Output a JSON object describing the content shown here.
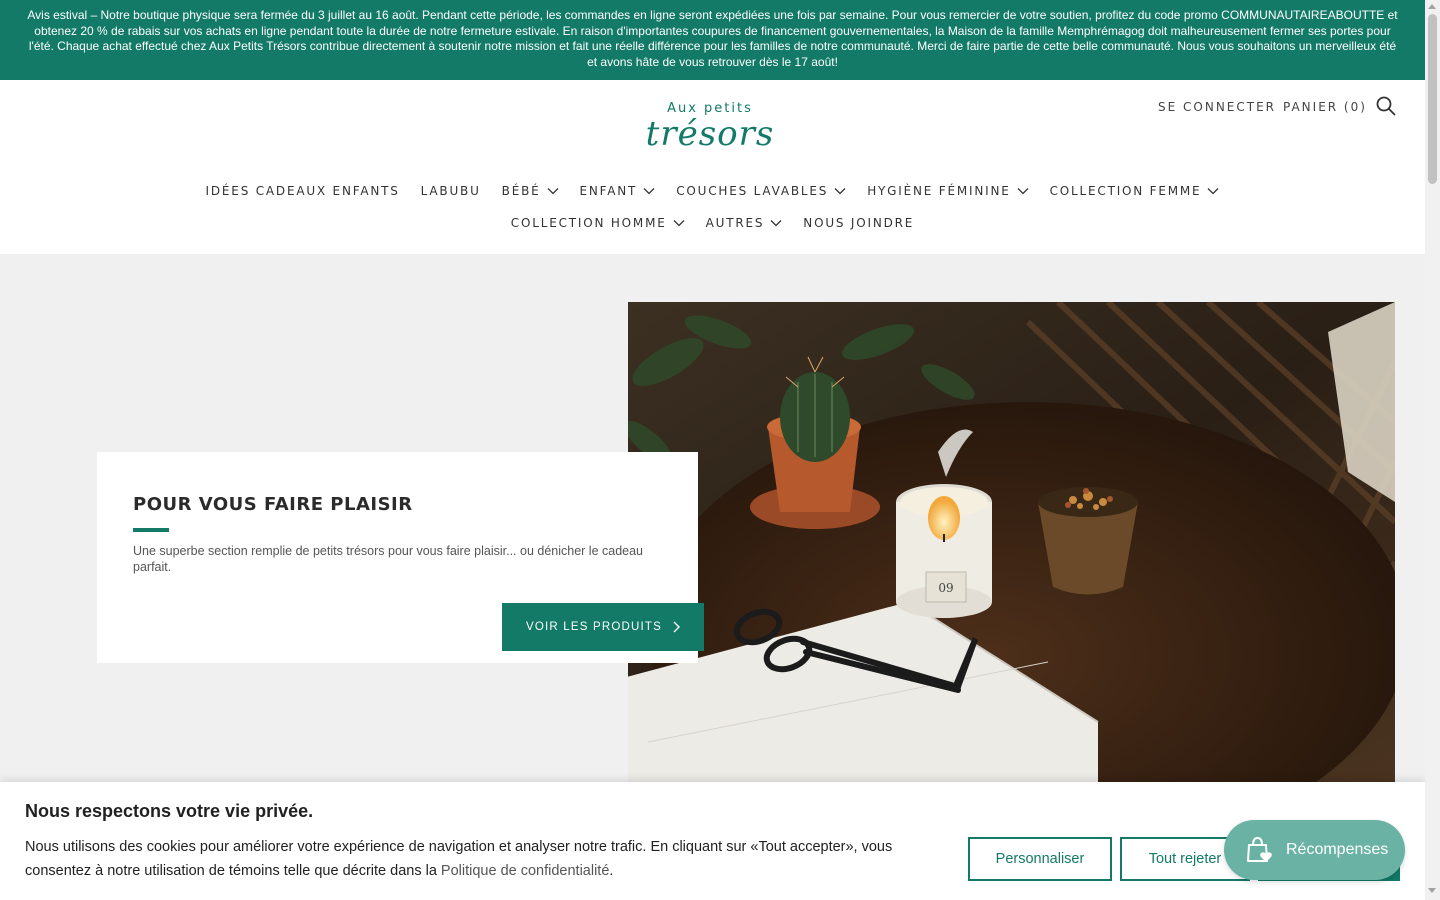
{
  "announcement": {
    "text": "Avis estival – Notre boutique physique sera fermée du 3 juillet au 16 août. Pendant cette période, les commandes en ligne seront expédiées une fois par semaine. Pour vous remercier de votre soutien, profitez du code promo COMMUNAUTAIREABOUTTE et obtenez 20 % de rabais sur vos achats en ligne pendant toute la durée de notre fermeture estivale.    En raison d'importantes coupures de financement gouvernementales, la Maison de la famille Memphrémagog doit malheureusement fermer ses portes pour l'été. Chaque achat effectué chez Aux Petits Trésors contribue directement à soutenir notre mission et fait une réelle différence pour les familles de notre communauté. Merci de faire partie de cette belle communauté. Nous vous souhaitons un merveilleux été et avons hâte de vous retrouver dès le 17 août!"
  },
  "logo": {
    "small": "Aux petits",
    "big": "trésors"
  },
  "header": {
    "login": "SE CONNECTER",
    "cart": "PANIER (0)",
    "search_icon": "search-icon"
  },
  "nav": {
    "row1": [
      {
        "label": "IDÉES CADEAUX ENFANTS",
        "dropdown": false
      },
      {
        "label": "LABUBU",
        "dropdown": false
      },
      {
        "label": "BÉBÉ",
        "dropdown": true
      },
      {
        "label": "ENFANT",
        "dropdown": true
      },
      {
        "label": "COUCHES LAVABLES",
        "dropdown": true
      },
      {
        "label": "HYGIÈNE FÉMININE",
        "dropdown": true
      },
      {
        "label": "COLLECTION FEMME",
        "dropdown": true
      }
    ],
    "row2": [
      {
        "label": "COLLECTION HOMME",
        "dropdown": true
      },
      {
        "label": "AUTRES",
        "dropdown": true
      },
      {
        "label": "NOUS JOINDRE",
        "dropdown": false
      }
    ]
  },
  "hero": {
    "title": "POUR VOUS FAIRE PLAISIR",
    "text": "Une superbe section remplie de petits trésors pour vous faire plaisir... ou dénicher le cadeau parfait.",
    "button": "VOIR LES PRODUITS",
    "candle_label": "09"
  },
  "cookie": {
    "title": "Nous respectons votre vie privée.",
    "text": "Nous utilisons des cookies pour améliorer votre expérience de navigation et analyser notre trafic. En cliquant sur «Tout accepter», vous consentez à notre utilisation de témoins telle que décrite dans la ",
    "link": "Politique de confidentialité",
    "end": ".",
    "customize": "Personnaliser",
    "reject": "Tout rejeter"
  },
  "rewards": {
    "label": "Récompenses",
    "icon": "shopping-bag-heart-icon"
  },
  "colors": {
    "brand": "#127a67",
    "rewards": "#6ab3a4",
    "background": "#f0f0f0"
  }
}
